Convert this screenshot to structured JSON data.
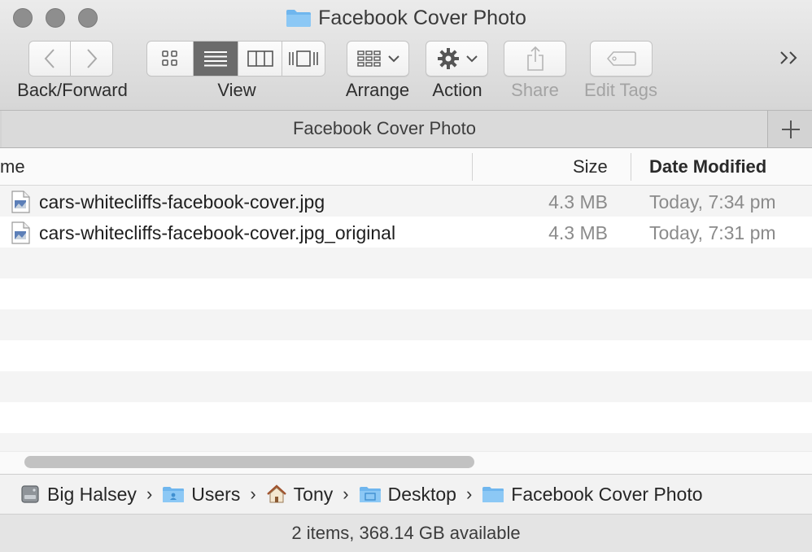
{
  "window": {
    "title": "Facebook Cover Photo"
  },
  "toolbar": {
    "back_forward_label": "Back/Forward",
    "view_label": "View",
    "arrange_label": "Arrange",
    "action_label": "Action",
    "share_label": "Share",
    "edit_tags_label": "Edit Tags",
    "overflow": "»",
    "active_view": "list"
  },
  "tab": {
    "label": "Facebook Cover Photo",
    "add": "+"
  },
  "columns": {
    "name": "me",
    "size": "Size",
    "date_modified": "Date Modified"
  },
  "files": [
    {
      "name": "cars-whitecliffs-facebook-cover.jpg",
      "size": "4.3 MB",
      "date": "Today, 7:34 pm",
      "icon": "image-file-icon"
    },
    {
      "name": "cars-whitecliffs-facebook-cover.jpg_original",
      "size": "4.3 MB",
      "date": "Today, 7:31 pm",
      "icon": "image-file-icon"
    }
  ],
  "path": [
    {
      "label": "Big Halsey",
      "icon": "hard-drive-icon"
    },
    {
      "label": "Users",
      "icon": "users-folder-icon"
    },
    {
      "label": "Tony",
      "icon": "home-icon"
    },
    {
      "label": "Desktop",
      "icon": "desktop-folder-icon"
    },
    {
      "label": "Facebook Cover Photo",
      "icon": "folder-icon"
    }
  ],
  "path_separator": "›",
  "status": {
    "text": "2 items, 368.14 GB available"
  },
  "colors": {
    "folder": "#6fb6ee",
    "active_segment": "#6b6b6b"
  }
}
